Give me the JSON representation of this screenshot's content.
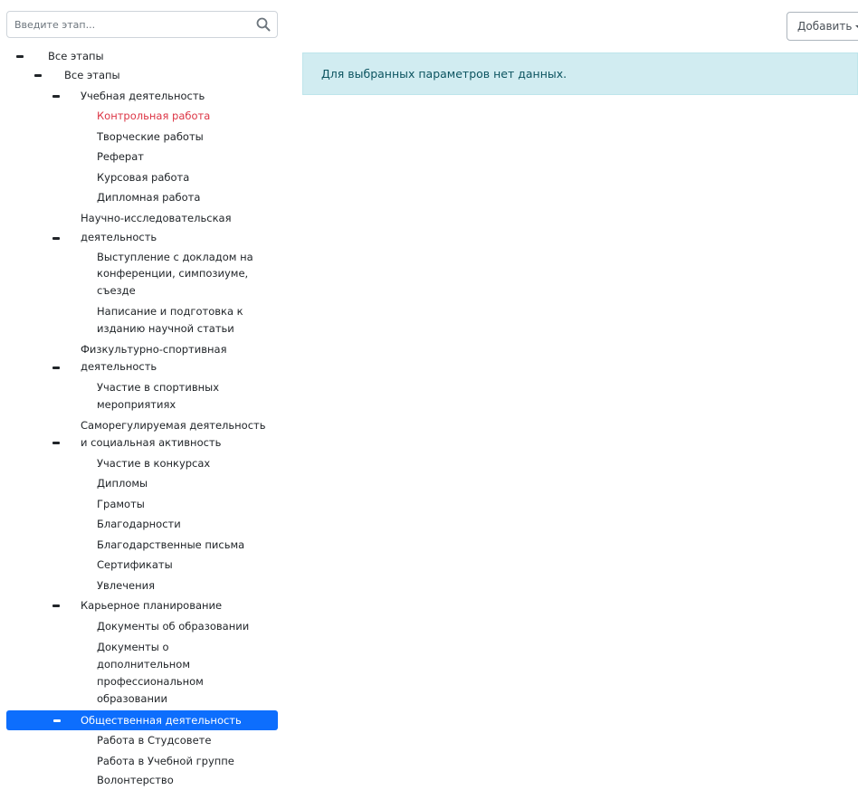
{
  "search": {
    "placeholder": "Введите этап..."
  },
  "tree": {
    "root": "Все этапы",
    "sub": "Все этапы",
    "study": {
      "label": "Учебная деятельность",
      "items": [
        "Контрольная работа",
        "Творческие работы",
        "Реферат",
        "Курсовая работа",
        "Дипломная работа"
      ]
    },
    "research": {
      "label1": "Научно-исследовательская",
      "label2": "деятельность",
      "item1": [
        "Выступление с докладом на",
        "конференции, симпозиуме,",
        "съезде"
      ],
      "item2": [
        "Написание и подготовка к",
        "изданию научной статьи"
      ]
    },
    "sport": {
      "label1": "Физкультурно-спортивная",
      "label2": "деятельность",
      "item1": [
        "Участие в спортивных",
        "мероприятиях"
      ]
    },
    "social": {
      "label1": "Саморегулируемая деятельность",
      "label2": "и социальная активность",
      "items": [
        "Участие в конкурсах",
        "Дипломы",
        "Грамоты",
        "Благодарности",
        "Благодарственные письма",
        "Сертификаты",
        "Увлечения"
      ]
    },
    "career": {
      "label": "Карьерное планирование",
      "item1": "Документы об образовании",
      "item2": [
        "Документы о",
        "дополнительном",
        "профессиональном",
        "образовании"
      ]
    },
    "public": {
      "label": "Общественная деятельность",
      "items": [
        "Работа в Студсовете",
        "Работа в Учебной группе",
        "Волонтерство"
      ]
    }
  },
  "toolbar": {
    "add_label": "Добавить"
  },
  "alert": {
    "text": "Для выбранных параметров нет данных."
  },
  "colors": {
    "selected": "#0d6efd",
    "active_item": "#dc3545",
    "alert_bg": "#d1ecf1",
    "alert_text": "#0c5460"
  },
  "icons": {
    "search": "search-icon",
    "collapse": "minus-icon",
    "dropdown": "chevron-down-icon"
  }
}
